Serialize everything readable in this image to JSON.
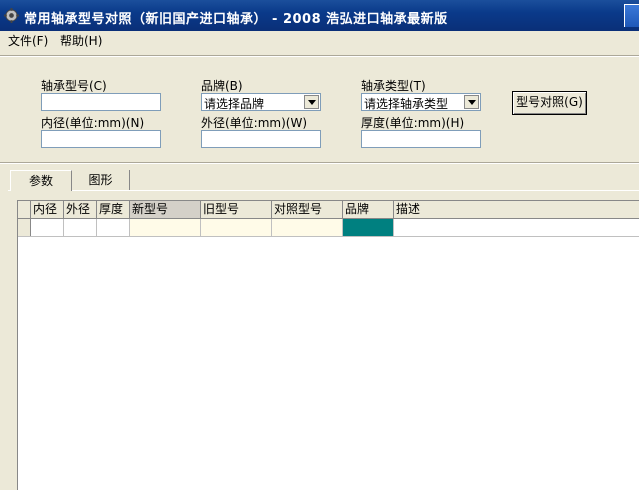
{
  "window": {
    "title": "常用轴承型号对照（新旧国产进口轴承）  - 2008 浩弘进口轴承最新版",
    "app_icon": "gear-icon"
  },
  "menu": {
    "file": "文件(F)",
    "help": "帮助(H)"
  },
  "form": {
    "bearing_model_label": "轴承型号(C)",
    "bearing_model_value": "",
    "brand_label": "品牌(B)",
    "brand_selected": "请选择品牌",
    "bearing_type_label": "轴承类型(T)",
    "bearing_type_selected": "请选择轴承类型",
    "inner_diameter_label": "内径(单位:mm)(N)",
    "inner_diameter_value": "",
    "outer_diameter_label": "外径(单位:mm)(W)",
    "outer_diameter_value": "",
    "thickness_label": "厚度(单位:mm)(H)",
    "thickness_value": "",
    "compare_button": "型号对照(G)"
  },
  "tabs": [
    {
      "label": "参数",
      "active": true
    },
    {
      "label": "图形",
      "active": false
    }
  ],
  "grid": {
    "columns": [
      "内径",
      "外径",
      "厚度",
      "新型号",
      "旧型号",
      "对照型号",
      "品牌",
      "描述"
    ],
    "rows": [
      [
        "",
        "",
        "",
        "",
        "",
        "",
        "",
        ""
      ]
    ],
    "colors": {
      "highlight_col_bg": "#fffbe8",
      "selected_cell_bg": "#008080"
    }
  }
}
